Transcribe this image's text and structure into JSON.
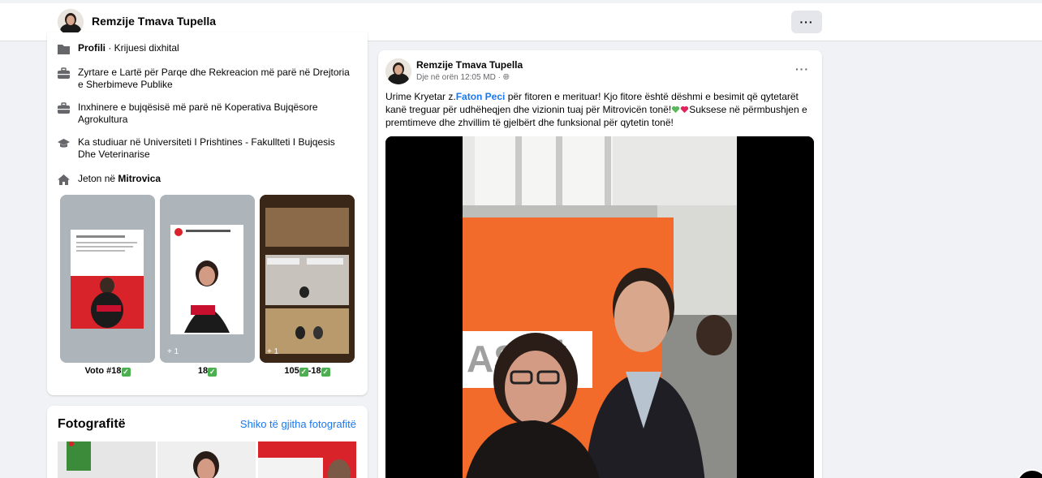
{
  "header": {
    "name": "Remzije Tmava Tupella",
    "more_label": "···"
  },
  "intro": {
    "items": [
      {
        "icon": "flag-icon",
        "bold": "Profili",
        "text": " · Krijuesi dixhital"
      },
      {
        "icon": "briefcase-icon",
        "text": "Zyrtare e Lartë për Parqe dhe Rekreacion më parë në Drejtoria e Sherbimeve Publike"
      },
      {
        "icon": "briefcase-icon",
        "text": "Inxhinere e bujqësisë më parë në Koperativa Bujqësore Agrokultura"
      },
      {
        "icon": "graduation-cap-icon",
        "text": "Ka studiuar në Universiteti I Prishtines - Fakullteti I Bujqesis Dhe Veterinarise"
      },
      {
        "icon": "home-icon",
        "text": "Jeton në ",
        "bold_after": "Mitrovica"
      }
    ],
    "highlights": [
      {
        "label": "Voto #18",
        "plus": ""
      },
      {
        "label": "18",
        "plus": "+ 1"
      },
      {
        "label": "105",
        "label2": "-18",
        "plus": "+ 1"
      }
    ]
  },
  "photos": {
    "title": "Fotografitë",
    "see_all": "Shiko të gjitha fotografitë"
  },
  "post": {
    "author": "Remzije Tmava Tupella",
    "time": "Dje në orën 12:05 MD",
    "text_before": "Urime Kryetar z.",
    "mention": "Faton Peci",
    "text_after": " për fitoren e merituar! Kjo fitore është dëshmi e besimit që qytetarët kanë treguar për udhëheqjen dhe vizionin tuaj për Mitrovicën tonë!",
    "text_after2": "Suksese në përmbushjen e premtimeve dhe zhvillim të gjelbërt dhe funksional për qytetin tonë!",
    "more_label": "···"
  },
  "colors": {
    "link": "#1877f2",
    "background": "#f0f2f5",
    "card": "#ffffff"
  }
}
